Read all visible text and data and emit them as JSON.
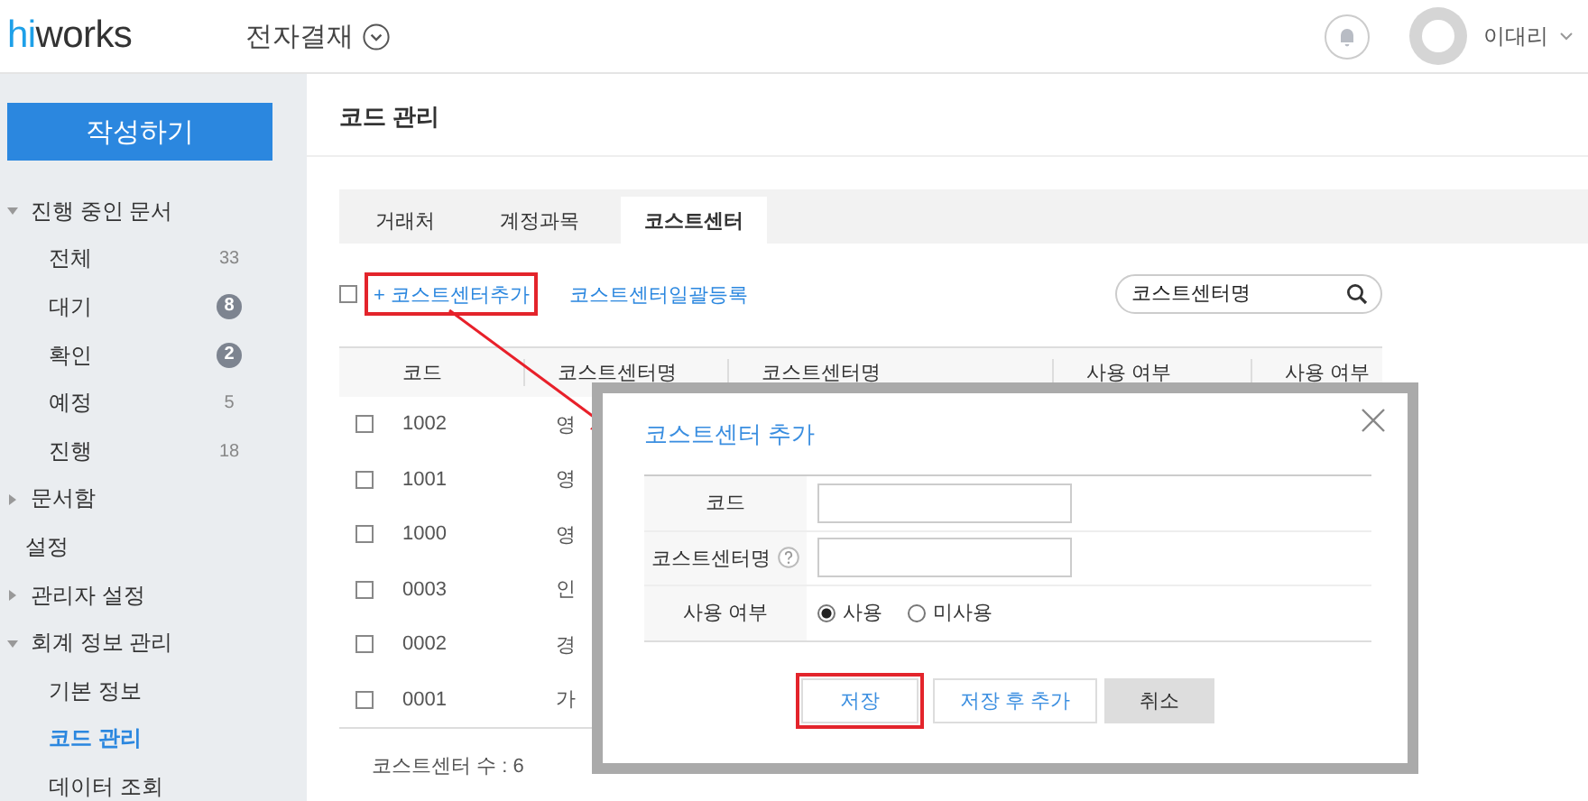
{
  "header": {
    "logo_prefix": "hi",
    "logo_suffix": "works",
    "app_menu": "전자결재",
    "user_name": "이대리"
  },
  "sidebar": {
    "compose_button": "작성하기",
    "items": [
      {
        "label": "진행 중인 문서",
        "expanded": true,
        "children": [
          {
            "label": "전체",
            "count": "33",
            "kind": "plain",
            "selected": false
          },
          {
            "label": "대기",
            "count": "8",
            "kind": "badge",
            "selected": false
          },
          {
            "label": "확인",
            "count": "2",
            "kind": "badge",
            "selected": false
          },
          {
            "label": "예정",
            "count": "5",
            "kind": "plain",
            "selected": false
          },
          {
            "label": "진행",
            "count": "18",
            "kind": "plain",
            "selected": false
          }
        ]
      },
      {
        "label": "문서함",
        "expanded": false
      },
      {
        "label": "설정"
      },
      {
        "label": "관리자 설정",
        "expanded": false
      },
      {
        "label": "회계 정보 관리",
        "expanded": true,
        "children": [
          {
            "label": "기본 정보",
            "selected": false
          },
          {
            "label": "코드 관리",
            "selected": true
          },
          {
            "label": "데이터 조회",
            "selected": false
          }
        ]
      }
    ]
  },
  "page_title": "코드 관리",
  "tabs": [
    {
      "label": "거래처",
      "selected": false
    },
    {
      "label": "계정과목",
      "selected": false
    },
    {
      "label": "코스트센터",
      "selected": true
    }
  ],
  "toolbar": {
    "select_all_checked": false,
    "add_link": "+ 코스트센터추가",
    "bulk_link": "코스트센터일괄등록",
    "search_placeholder": "코스트센터명"
  },
  "table": {
    "columns": [
      "코드",
      "코스트센터명",
      "코스트센터명",
      "사용 여부",
      "사용 여부"
    ],
    "rows": [
      {
        "code": "1002",
        "name": "영",
        "checked": false
      },
      {
        "code": "1001",
        "name": "영",
        "checked": false
      },
      {
        "code": "1000",
        "name": "영",
        "checked": false
      },
      {
        "code": "0003",
        "name": "인",
        "checked": false
      },
      {
        "code": "0002",
        "name": "경",
        "checked": false
      },
      {
        "code": "0001",
        "name": "가",
        "checked": false
      }
    ]
  },
  "footer": {
    "count": "코스트센터 수 : 6"
  },
  "dialog": {
    "title": "코스트센터 추가",
    "fields": [
      {
        "kind": "text",
        "label": "코드",
        "help": false
      },
      {
        "kind": "text",
        "label": "코스트센터명",
        "help": true
      },
      {
        "kind": "radio",
        "label": "사용 여부",
        "options": [
          {
            "label": "사용",
            "selected": true
          },
          {
            "label": "미사용",
            "selected": false
          }
        ]
      }
    ],
    "buttons": [
      {
        "label": "저장",
        "kind": "primary",
        "highlighted": true
      },
      {
        "label": "저장 후 추가",
        "kind": "secondary",
        "highlighted": false
      },
      {
        "label": "취소",
        "kind": "cancel",
        "highlighted": false
      }
    ]
  }
}
